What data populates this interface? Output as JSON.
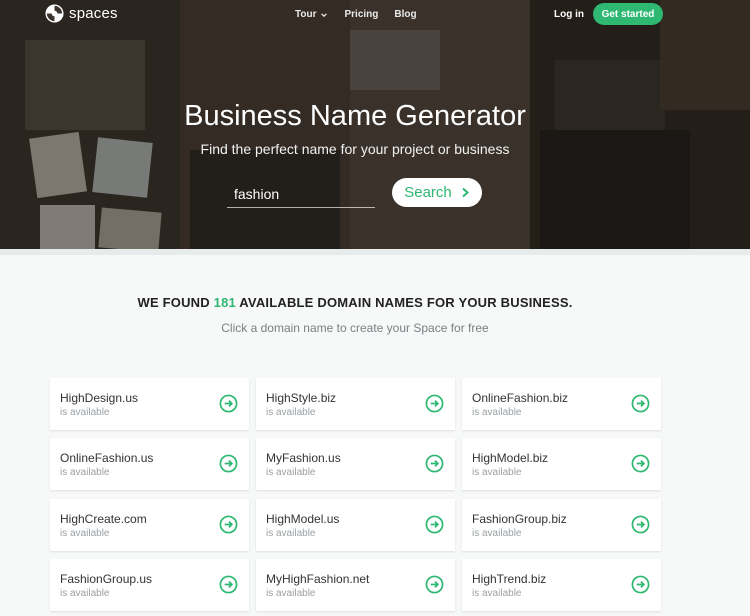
{
  "nav": {
    "logo_text": "spaces",
    "links": [
      "Tour",
      "Pricing",
      "Blog"
    ],
    "login": "Log in",
    "cta": "Get started"
  },
  "hero": {
    "title": "Business Name Generator",
    "subtitle": "Find the perfect name for your project or business",
    "search_value": "fashion",
    "search_button": "Search"
  },
  "results": {
    "prefix": "WE FOUND",
    "count": "181",
    "suffix": "AVAILABLE DOMAIN NAMES FOR YOUR BUSINESS.",
    "subtitle": "Click a domain name to create your Space for free",
    "domains": [
      {
        "name": "HighDesign.us",
        "status": "is available"
      },
      {
        "name": "HighStyle.biz",
        "status": "is available"
      },
      {
        "name": "OnlineFashion.biz",
        "status": "is available"
      },
      {
        "name": "OnlineFashion.us",
        "status": "is available"
      },
      {
        "name": "MyFashion.us",
        "status": "is available"
      },
      {
        "name": "HighModel.biz",
        "status": "is available"
      },
      {
        "name": "HighCreate.com",
        "status": "is available"
      },
      {
        "name": "HighModel.us",
        "status": "is available"
      },
      {
        "name": "FashionGroup.biz",
        "status": "is available"
      },
      {
        "name": "FashionGroup.us",
        "status": "is available"
      },
      {
        "name": "MyHighFashion.net",
        "status": "is available"
      },
      {
        "name": "HighTrend.biz",
        "status": "is available"
      }
    ]
  },
  "colors": {
    "accent": "#2eb872",
    "page_bg": "#f7f8f8",
    "card_bg": "#ffffff"
  },
  "icons": {
    "logo": "spaces-logo-icon",
    "nav_dropdown": "chevron-down-icon",
    "search": "chevron-right-icon",
    "domain_go": "arrow-circle-right-icon"
  }
}
